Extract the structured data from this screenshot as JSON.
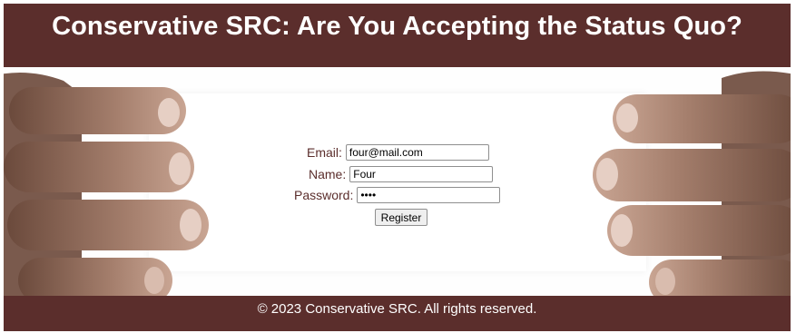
{
  "header": {
    "title": "Conservative SRC: Are You Accepting the Status Quo?"
  },
  "form": {
    "email_label": "Email:",
    "email_value": "four@mail.com",
    "name_label": "Name:",
    "name_value": "Four",
    "password_label": "Password:",
    "password_value": "••••",
    "register_label": "Register"
  },
  "footer": {
    "text": "© 2023 Conservative SRC. All rights reserved."
  },
  "colors": {
    "brand": "#5b2e2c",
    "background": "#ffffff"
  },
  "icons": {
    "left_image": "hand-holding-left-image",
    "right_image": "hand-holding-right-image"
  }
}
